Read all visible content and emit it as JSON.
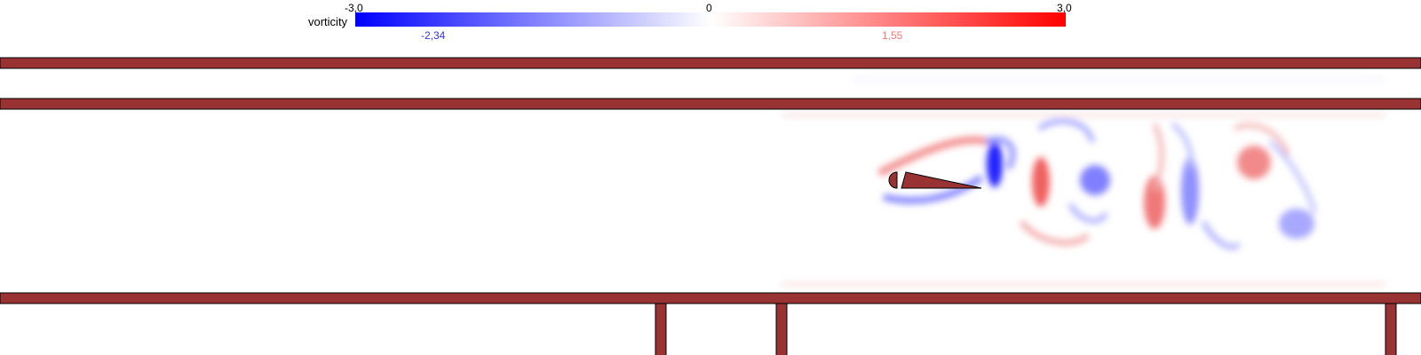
{
  "colorbar": {
    "label": "vorticity",
    "min_label": "-3,0",
    "zero_label": "0",
    "max_label": "3,0",
    "min_value": -3.0,
    "max_value": 3.0,
    "min_color": "#0000ff",
    "mid_color": "#ffffff",
    "max_color": "#ff0000"
  },
  "markers": {
    "field_min_label": "-2,34",
    "field_min_value": -2.34,
    "field_min_color": "#3333ff",
    "field_max_label": "1,55",
    "field_max_value": 1.55,
    "field_max_color": "#ff7777"
  },
  "geometry_color": "#993333"
}
